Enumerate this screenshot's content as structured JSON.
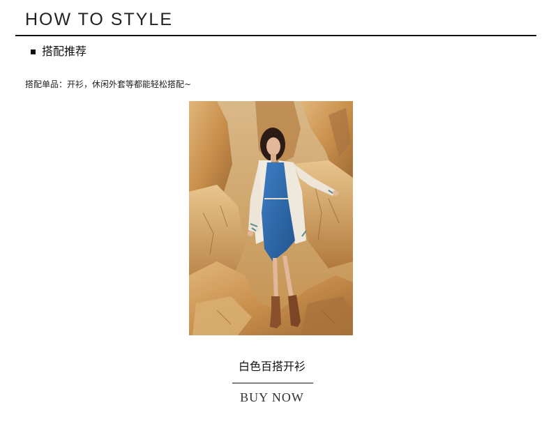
{
  "header": {
    "title": "HOW TO STYLE"
  },
  "section": {
    "heading": "搭配推荐",
    "note": "搭配单品：开衫，休闲外套等都能轻松搭配~"
  },
  "product": {
    "name": "白色百搭开衫",
    "cta_label": "BUY NOW"
  },
  "colors": {
    "text": "#222222",
    "rule": "#111111",
    "background": "#ffffff"
  }
}
